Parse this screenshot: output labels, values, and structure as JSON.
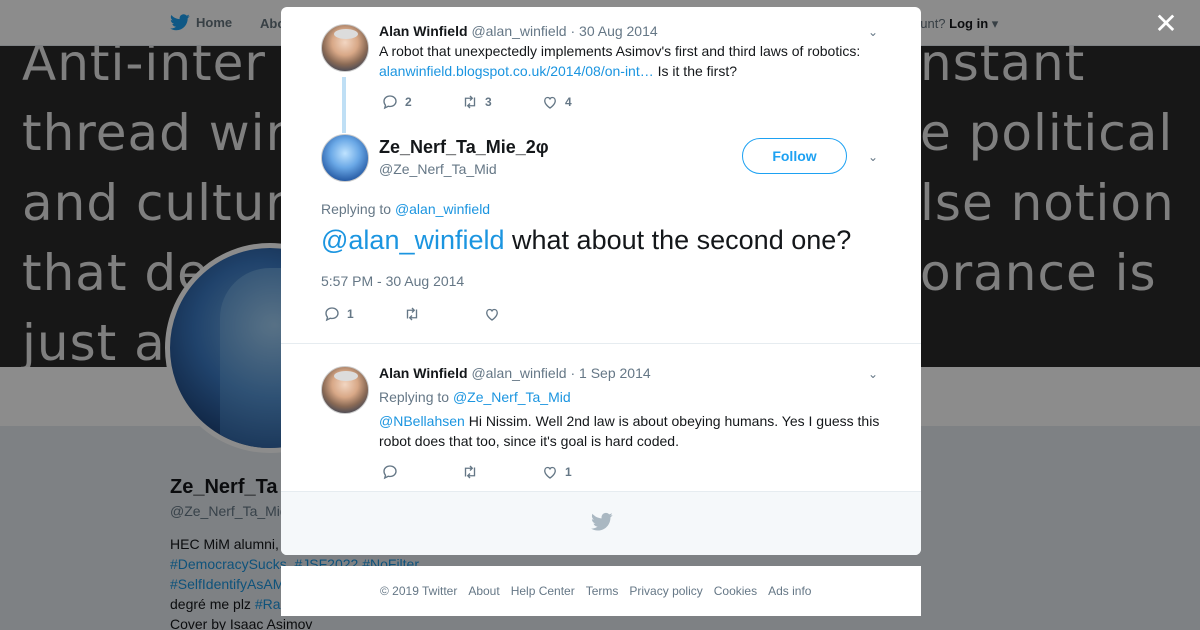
{
  "topbar": {
    "home_label": "Home",
    "about_label": "Abo",
    "account_prompt": "ccount?",
    "login_label": "Log in"
  },
  "banner": {
    "left_lines": [
      "Anti-inter",
      "thread wir",
      "and cultur",
      "that de",
      "just a"
    ],
    "right_lines": [
      "nstant",
      "e political",
      "lse notion",
      "orance is"
    ]
  },
  "profile": {
    "name": "Ze_Nerf_Ta",
    "handle": "@Ze_Nerf_Ta_Mid",
    "bio_line1": "HEC MiM alumni,",
    "bio_tags1": [
      "#DemocracySucks",
      "#JSF2022",
      "#NoFilter"
    ],
    "bio_tag2": "#SelfIdentifyAsAM",
    "bio_line3_text": "degré me plz",
    "bio_tag3": "#Ra",
    "bio_line4": "Cover by Isaac Asimov"
  },
  "parent_tweet": {
    "author_name": "Alan Winfield",
    "author_handle": "@alan_winfield",
    "date": "· 30 Aug 2014",
    "text_line1": "A robot that unexpectedly implements Asimov's first and third laws of robotics:",
    "link_text": "alanwinfield.blogspot.co.uk/2014/08/on-int…",
    "text_after_link": " Is it the first?",
    "reply_count": "2",
    "retweet_count": "3",
    "like_count": "4"
  },
  "main_tweet": {
    "author_name": "Ze_Nerf_Ta_Mie_2φ",
    "author_handle": "@Ze_Nerf_Ta_Mid",
    "follow_label": "Follow",
    "replying_prefix": "Replying to ",
    "replying_handle": "@alan_winfield",
    "mention": "@alan_winfield",
    "text": " what about the second one?",
    "timestamp": "5:57 PM - 30 Aug 2014",
    "reply_count": "1",
    "retweet_count": "",
    "like_count": ""
  },
  "reply_tweet": {
    "author_name": "Alan Winfield",
    "author_handle": "@alan_winfield",
    "date": "· 1 Sep 2014",
    "replying_prefix": "Replying to ",
    "replying_handle": "@Ze_Nerf_Ta_Mid",
    "mention": "@NBellahsen",
    "text_line1": " Hi Nissim. Well 2nd law is about obeying humans. Yes I guess this",
    "text_line2": "robot does that too, since it's goal is hard coded.",
    "reply_count": "",
    "retweet_count": "",
    "like_count": "1"
  },
  "footer": {
    "links": [
      "© 2019 Twitter",
      "About",
      "Help Center",
      "Terms",
      "Privacy policy",
      "Cookies",
      "Ads info"
    ]
  },
  "icons": {
    "close": "close-icon",
    "bird": "twitter-bird-icon",
    "reply": "reply-icon",
    "retweet": "retweet-icon",
    "like": "heart-icon",
    "chevron": "chevron-down-icon"
  },
  "colors": {
    "brand": "#1da1f2",
    "link": "#1b95e0",
    "muted": "#657786",
    "thread_line": "#bfdff5"
  }
}
